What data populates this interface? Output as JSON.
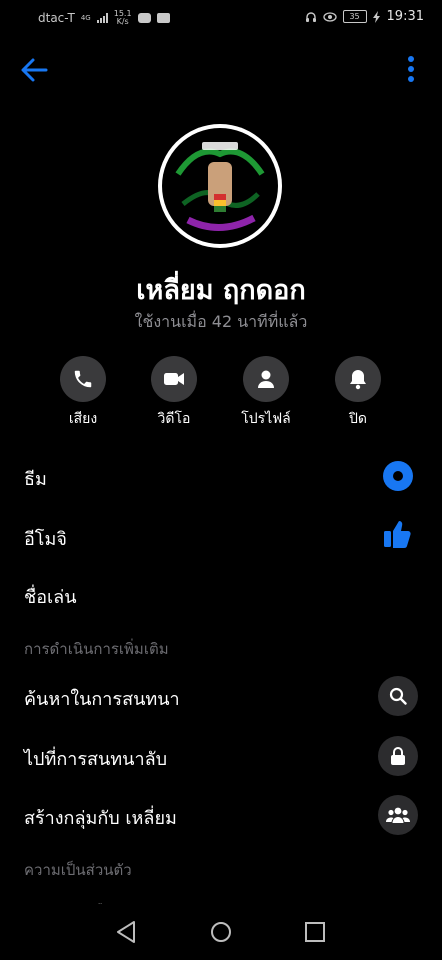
{
  "status_bar": {
    "carrier": "dtac-T",
    "network": "4G",
    "net_speed_value": "15.1",
    "net_speed_unit": "K/s",
    "battery": "35",
    "time": "19:31"
  },
  "profile": {
    "name": "เหลี่ยม ฤกดอก",
    "last_active": "ใช้งานเมื่อ 42 นาทีที่แล้ว"
  },
  "actions": [
    {
      "label": "เสียง",
      "icon": "phone-icon"
    },
    {
      "label": "วิดีโอ",
      "icon": "video-camera-icon"
    },
    {
      "label": "โปรไฟล์",
      "icon": "profile-icon"
    },
    {
      "label": "ปิด",
      "icon": "bell-icon"
    }
  ],
  "settings": {
    "theme": "ธีม",
    "emoji": "อีโมจิ",
    "nickname": "ชื่อเล่น",
    "more_actions_header": "การดำเนินการเพิ่มเติม",
    "search": "ค้นหาในการสนทนา",
    "secret": "ไปที่การสนทนาลับ",
    "create_group": "สร้างกลุ่มกับ เหลี่ยม",
    "privacy_header": "ความเป็นส่วนตัว",
    "notifications": "การแจ้งเตือน"
  },
  "colors": {
    "accent": "#1877f2",
    "background": "#000000",
    "secondary_text": "#8e8e93"
  }
}
